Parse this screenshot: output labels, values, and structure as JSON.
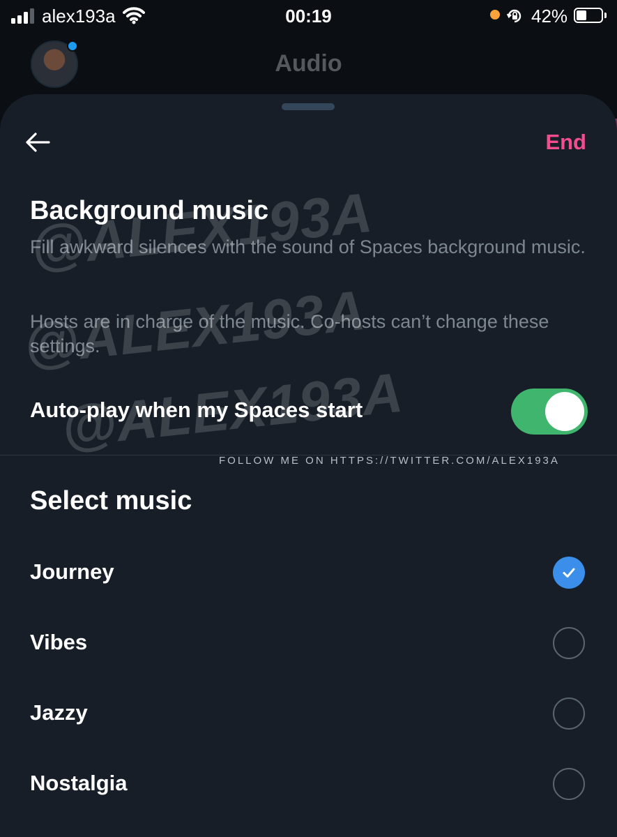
{
  "status_bar": {
    "carrier": "alex193a",
    "time": "00:19",
    "battery_percent": "42%",
    "battery_level": 0.42,
    "signal_bars": 3,
    "icons": [
      "signal-icon",
      "wifi-icon",
      "orange-dot-indicator",
      "orientation-lock-icon",
      "battery-icon"
    ]
  },
  "background_header": {
    "title": "Audio"
  },
  "sheet": {
    "back_icon": "arrow-left-icon",
    "end_label": "End",
    "background_music": {
      "title": "Background music",
      "description_1": "Fill awkward silences with the sound of Spaces background music.",
      "description_2": "Hosts are in charge of the music. Co-hosts can’t change these settings."
    },
    "autoplay": {
      "label": "Auto-play when my Spaces start",
      "enabled": true
    },
    "select_music": {
      "title": "Select music",
      "options": [
        {
          "label": "Journey",
          "selected": true
        },
        {
          "label": "Vibes",
          "selected": false
        },
        {
          "label": "Jazzy",
          "selected": false
        },
        {
          "label": "Nostalgia",
          "selected": false
        }
      ]
    }
  },
  "overlay": {
    "watermark": "@ALEX193A",
    "follow_text": "FOLLOW ME ON HTTPS://TWITTER.COM/ALEX193A"
  },
  "colors": {
    "sheet_bg": "#171e28",
    "accent_pink": "#f24e8f",
    "toggle_green": "#3fb56e",
    "check_blue": "#3b8eea"
  }
}
